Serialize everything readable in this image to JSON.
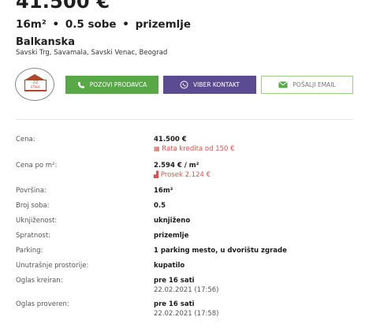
{
  "header": {
    "price": "41.500 €",
    "area": "16m²",
    "rooms": "0.5 sobe",
    "floor": "prizemlje",
    "separator": "•",
    "street": "Balkanska",
    "location": "Savski Trg, Savamala, Savski Venac, Beograd"
  },
  "logo": {
    "text": "ZiZ",
    "subtext": "ETIKA"
  },
  "buttons": {
    "call": "POZOVI PRODAVCA",
    "viber": "VIBER KONTAKT",
    "email": "POŠALJI EMAIL"
  },
  "details": [
    {
      "label": "Cena:",
      "value": "41.500 €",
      "sub": "Rata kredita od 150 €",
      "sub_style": "red"
    },
    {
      "label": "Cena po m²:",
      "value": "2.594 € / m²",
      "sub": "Prosek 2.124 €",
      "sub_style": "red"
    },
    {
      "label": "Površina:",
      "value": "16m²"
    },
    {
      "label": "Broj soba:",
      "value": "0.5"
    },
    {
      "label": "Uknjiženost:",
      "value": "uknjiženo"
    },
    {
      "label": "Spratnost:",
      "value": "prizemlje"
    },
    {
      "label": "Parking:",
      "value": "1 parking mesto, u dvorištu zgrade"
    },
    {
      "label": "Unutrašnje prostorije:",
      "value": "kupatilo"
    },
    {
      "label": "Oglas kreiran:",
      "value": "pre 16 sati",
      "sub": "22.02.2021 (17:56)",
      "sub_style": "gray"
    },
    {
      "label": "Oglas proveren:",
      "value": "pre 16 sati",
      "sub": "22.02.2021 (17:58)",
      "sub_style": "gray"
    }
  ],
  "colors": {
    "call": "#59a847",
    "viber": "#5b4b93",
    "email_border": "#9bcf8a",
    "accent_red": "#d9534f"
  }
}
